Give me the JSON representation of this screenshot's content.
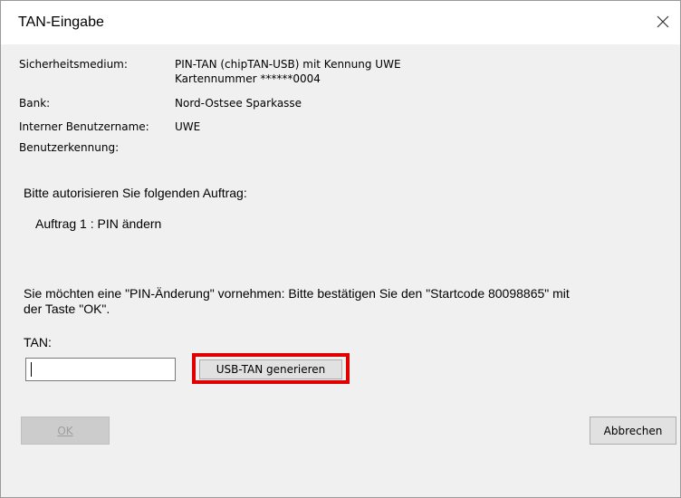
{
  "window": {
    "title": "TAN-Eingabe",
    "close_icon": "close-icon"
  },
  "info": {
    "security_medium_label": "Sicherheitsmedium:",
    "security_medium_line1": "PIN-TAN (chipTAN-USB) mit Kennung UWE",
    "security_medium_line2": "Kartennummer ******0004",
    "bank_label": "Bank:",
    "bank_value": "Nord-Ostsee Sparkasse",
    "internal_user_label": "Interner Benutzername:",
    "internal_user_value": "UWE",
    "user_id_label": "Benutzerkennung:",
    "user_id_value": ""
  },
  "order": {
    "prompt": "Bitte autorisieren Sie folgenden Auftrag:",
    "item": "Auftrag 1 : PIN ändern"
  },
  "instructions": {
    "line1": "Sie möchten eine \"PIN-Änderung\" vornehmen: Bitte bestätigen Sie den \"Startcode 80098865\" mit",
    "line2": "der Taste \"OK\"."
  },
  "tan": {
    "label": "TAN:",
    "value": "",
    "generate_button": "USB-TAN generieren",
    "highlight_color": "#e00000"
  },
  "buttons": {
    "ok": "OK",
    "cancel": "Abbrechen"
  }
}
